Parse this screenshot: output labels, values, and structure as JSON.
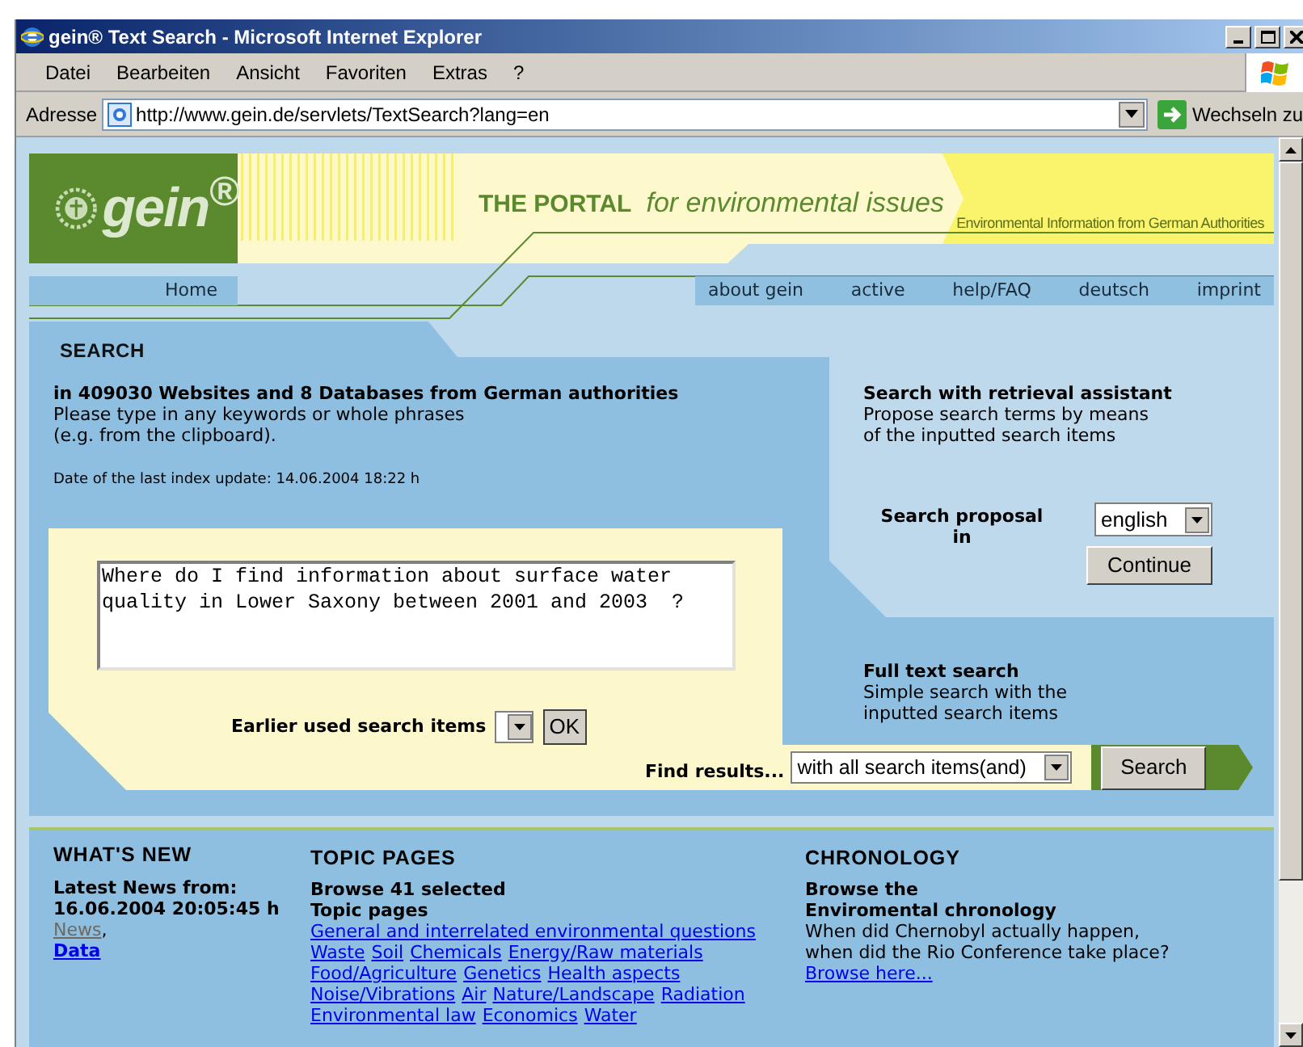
{
  "window": {
    "title": "gein® Text Search - Microsoft Internet Explorer"
  },
  "menu": [
    "Datei",
    "Bearbeiten",
    "Ansicht",
    "Favoriten",
    "Extras",
    "?"
  ],
  "address_bar": {
    "label": "Adresse",
    "url": "http://www.gein.de/servlets/TextSearch?lang=en",
    "go_label": "Wechseln zu"
  },
  "header": {
    "logo": "gein$^{®}$",
    "portal": "THE PORTAL",
    "tagline": "for environmental issues",
    "subtitle": "Environmental Information from German Authorities"
  },
  "nav": {
    "home": "Home",
    "items": [
      "about gein",
      "active",
      "help/FAQ",
      "deutsch",
      "imprint"
    ]
  },
  "search": {
    "title": "SEARCH",
    "heading": "in 409030 Websites and 8 Databases from German authorities",
    "description": "Please type in any keywords or whole phrases\n(e.g. from the clipboard).",
    "index_date": "Date of the last index update: 14.06.2004 18:22 h",
    "query": "Where do I find information about surface water quality in Lower Saxony between 2001 and 2003  ?",
    "earlier_label": "Earlier used search items",
    "ok_button": "OK",
    "find_label": "Find results...",
    "find_option": "with all search items(and)",
    "search_button": "Search"
  },
  "assistant": {
    "title": "Search with retrieval assistant",
    "description": "Propose search terms by means\nof the inputted search items",
    "proposal_label": "Search proposal\nin",
    "language": "english",
    "continue_button": "Continue"
  },
  "fulltext": {
    "title": "Full text search",
    "description": "Simple search with the\ninputted search items"
  },
  "whats_new": {
    "title": "WHAT'S NEW",
    "text": "Latest News from:\n16.06.2004 20:05:45 h",
    "links": [
      {
        "label": "News",
        "visited": true,
        "bold": false,
        "after": ","
      },
      {
        "label": "Data",
        "visited": false,
        "bold": true
      }
    ]
  },
  "topics": {
    "title": "TOPIC PAGES",
    "text": "Browse 41 selected\nTopic pages",
    "link_rows": [
      [
        "General and interrelated environmental questions"
      ],
      [
        "Waste",
        "Soil",
        "Chemicals",
        "Energy/Raw materials"
      ],
      [
        "Food/Agriculture",
        "Genetics",
        "Health aspects"
      ],
      [
        "Noise/Vibrations",
        "Air",
        "Nature/Landscape",
        "Radiation"
      ],
      [
        "Environmental law",
        "Economics",
        "Water"
      ]
    ]
  },
  "chronology": {
    "title": "CHRONOLOGY",
    "heading": "Browse the\nEnviromental chronology",
    "text": "When did Chernobyl actually happen,\nwhen did the Rio Conference take place?",
    "link": "Browse here..."
  }
}
